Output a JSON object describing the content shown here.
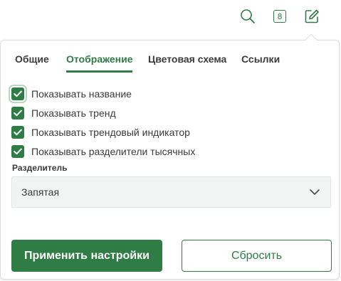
{
  "header": {
    "counter_value": "8"
  },
  "tabs": [
    {
      "label": "Общие",
      "active": false
    },
    {
      "label": "Отображение",
      "active": true
    },
    {
      "label": "Цветовая схема",
      "active": false
    },
    {
      "label": "Ссылки",
      "active": false
    }
  ],
  "options": [
    {
      "label": "Показывать название",
      "checked": true
    },
    {
      "label": "Показывать тренд",
      "checked": true
    },
    {
      "label": "Показывать трендовый индикатор",
      "checked": true
    },
    {
      "label": "Показывать разделители тысячных",
      "checked": true
    }
  ],
  "separator": {
    "label": "Разделитель",
    "value": "Запятая"
  },
  "buttons": {
    "apply": "Применить настройки",
    "reset": "Сбросить"
  },
  "colors": {
    "accent": "#2e7d46",
    "select_bg": "#f2f3f3",
    "border": "#dedede"
  },
  "icons": {
    "search": "search-icon",
    "counter": "counter-badge-icon",
    "edit": "edit-icon",
    "checkbox": "check-icon",
    "dropdown": "chevron-down-icon"
  }
}
